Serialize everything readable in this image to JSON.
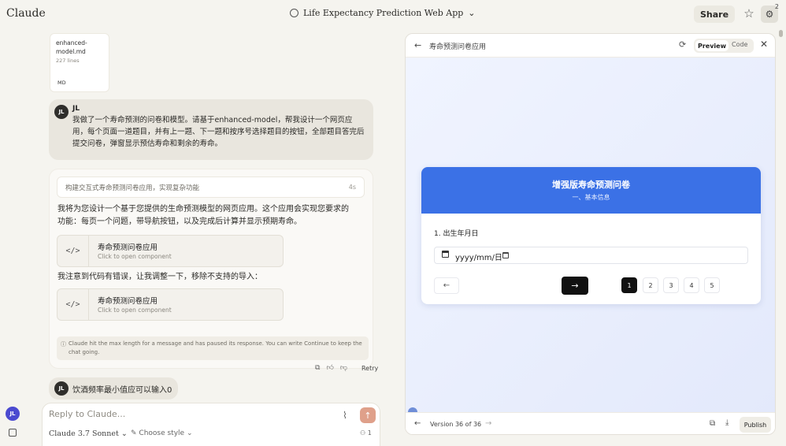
{
  "app": {
    "brand": "Claude"
  },
  "header": {
    "project_title": "Life Expectancy Prediction Web App",
    "share_label": "Share",
    "badge_count": "2"
  },
  "file_card": {
    "name": "enhanced-model.md",
    "lines": "227 lines",
    "type": "MD"
  },
  "messages": {
    "user1": {
      "initials": "JL",
      "name": "JL",
      "text": "我做了一个寿命预测的问卷和模型。请基于enhanced-model，帮我设计一个网页应用，每个页面一道题目，并有上一题、下一题和按序号选择题目的按钮，全部题目答完后提交问卷，弹窗显示预估寿命和剩余的寿命。"
    },
    "assistant": {
      "thinking_label": "构建交互式寿命预测问卷应用，实现复杂功能",
      "thinking_time": "4s",
      "para1": "我将为您设计一个基于您提供的生命预测模型的网页应用。这个应用会实现您要求的功能：每页一个问题，带导航按钮，以及完成后计算并显示预期寿命。",
      "component1": {
        "title": "寿命预测问卷应用",
        "subtitle": "Click to open component",
        "icon": "</>"
      },
      "para2": "我注意到代码有错误，让我调整一下，移除不支持的导入：",
      "component2": {
        "title": "寿命预测问卷应用",
        "subtitle": "Click to open component",
        "icon": "</>"
      },
      "notice": "Claude hit the max length for a message and has paused its response. You can write Continue to keep the chat going.",
      "retry_label": "Retry"
    },
    "user2": {
      "initials": "JL",
      "text": "饮酒频率最小值应可以输入0"
    }
  },
  "sidebar": {
    "user_initials": "JL"
  },
  "composer": {
    "placeholder": "Reply to Claude...",
    "model": "Claude 3.7 Sonnet",
    "style": "Choose style",
    "people_count": "1"
  },
  "artifact": {
    "title": "寿命预测问卷应用",
    "tab_preview": "Preview",
    "tab_code": "Code",
    "questionnaire": {
      "title": "增强版寿命预测问卷",
      "section": "一、基本信息",
      "question": "1. 出生年月日",
      "date_value": "yyyy/mm/日",
      "pages": [
        "1",
        "2",
        "3",
        "4",
        "5"
      ],
      "current_page": "1"
    },
    "version": "Version 36 of 36",
    "publish_label": "Publish"
  }
}
